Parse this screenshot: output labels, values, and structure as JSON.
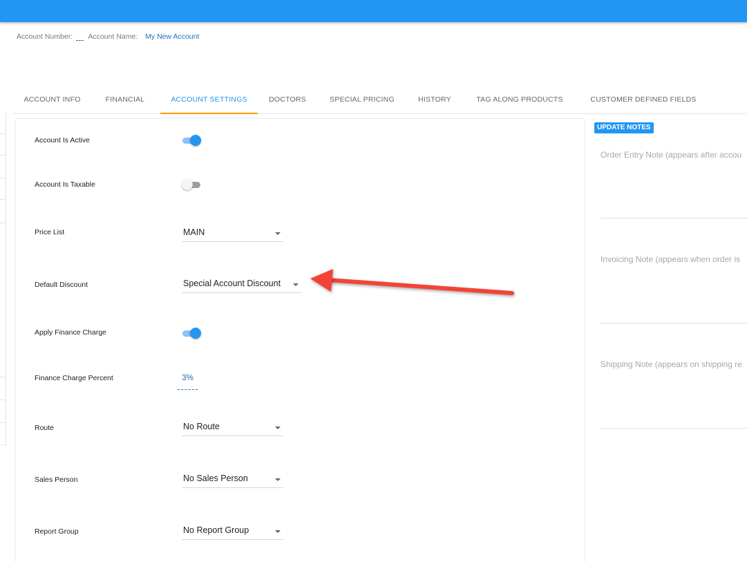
{
  "header": {
    "account_number_label": "Account Number:",
    "account_number_value": "",
    "account_name_label": "Account Name:",
    "account_name_value": "My New Account"
  },
  "tabs": [
    {
      "label": "ACCOUNT INFO"
    },
    {
      "label": "FINANCIAL"
    },
    {
      "label": "ACCOUNT SETTINGS",
      "active": true
    },
    {
      "label": "DOCTORS"
    },
    {
      "label": "SPECIAL PRICING"
    },
    {
      "label": "HISTORY"
    },
    {
      "label": "TAG ALONG PRODUCTS"
    },
    {
      "label": "CUSTOMER DEFINED FIELDS"
    }
  ],
  "settings": {
    "active": {
      "label": "Account Is Active",
      "on": true
    },
    "taxable": {
      "label": "Account Is Taxable",
      "on": false
    },
    "price_list": {
      "label": "Price List",
      "value": "MAIN"
    },
    "default_discount": {
      "label": "Default Discount",
      "value": "Special Account Discount"
    },
    "finance_charge": {
      "label": "Apply Finance Charge",
      "on": true
    },
    "finance_percent": {
      "label": "Finance Charge Percent",
      "value": "3%"
    },
    "route": {
      "label": "Route",
      "value": "No Route"
    },
    "sales_person": {
      "label": "Sales Person",
      "value": "No Sales Person"
    },
    "report_group": {
      "label": "Report Group",
      "value": "No Report Group"
    }
  },
  "notes": {
    "update_label": "UPDATE NOTES",
    "order_entry_placeholder": "Order Entry Note (appears after accou",
    "invoicing_placeholder": "Invoicing Note (appears when order is",
    "shipping_placeholder": "Shipping Note (appears on shipping re"
  },
  "colors": {
    "primary": "#2196f3",
    "tab_indicator": "#ff9800",
    "annotation_arrow": "#f44336"
  }
}
